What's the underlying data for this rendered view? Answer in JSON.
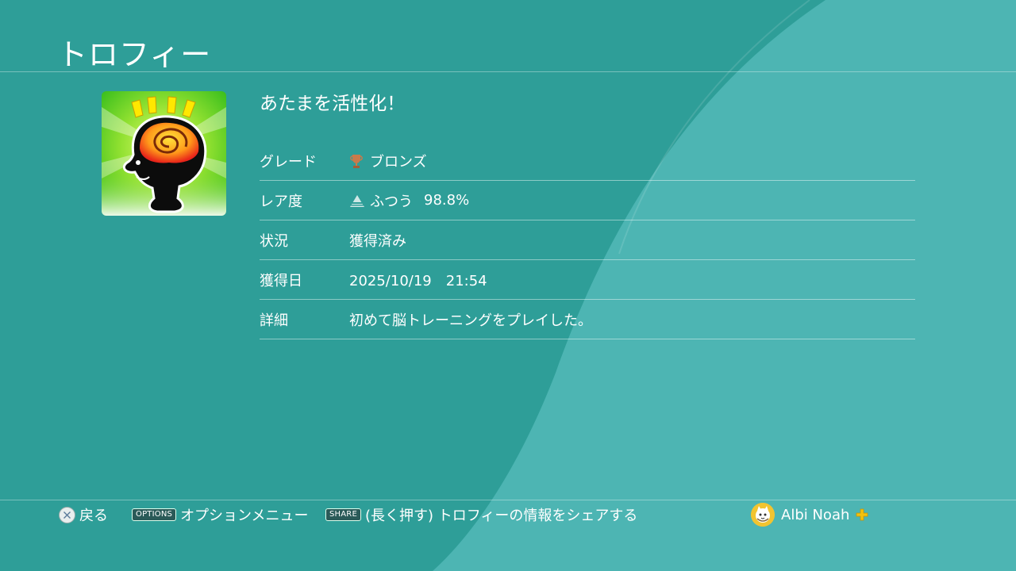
{
  "header": {
    "title": "トロフィー"
  },
  "trophy": {
    "name": "あたまを活性化！",
    "icon": "brain-training-icon",
    "rows": [
      {
        "label": "グレード",
        "value": "ブロンズ",
        "icon": "bronze-trophy-icon"
      },
      {
        "label": "レア度",
        "value": "ふつう",
        "percent": "98.8%",
        "icon": "rarity-common-icon"
      },
      {
        "label": "状況",
        "value": "獲得済み"
      },
      {
        "label": "獲得日",
        "value": "2025/10/19　21:54"
      },
      {
        "label": "詳細",
        "value": "初めて脳トレーニングをプレイした。"
      }
    ]
  },
  "footer": {
    "back_label": "戻る",
    "options_button": "OPTIONS",
    "options_label": "オプションメニュー",
    "share_button": "SHARE",
    "share_label": "(長く押す) トロフィーの情報をシェアする",
    "user_name": "Albi Noah"
  },
  "colors": {
    "background": "#2e9e98",
    "wave": "#4db5b3",
    "bronze": "#c97a4a"
  }
}
